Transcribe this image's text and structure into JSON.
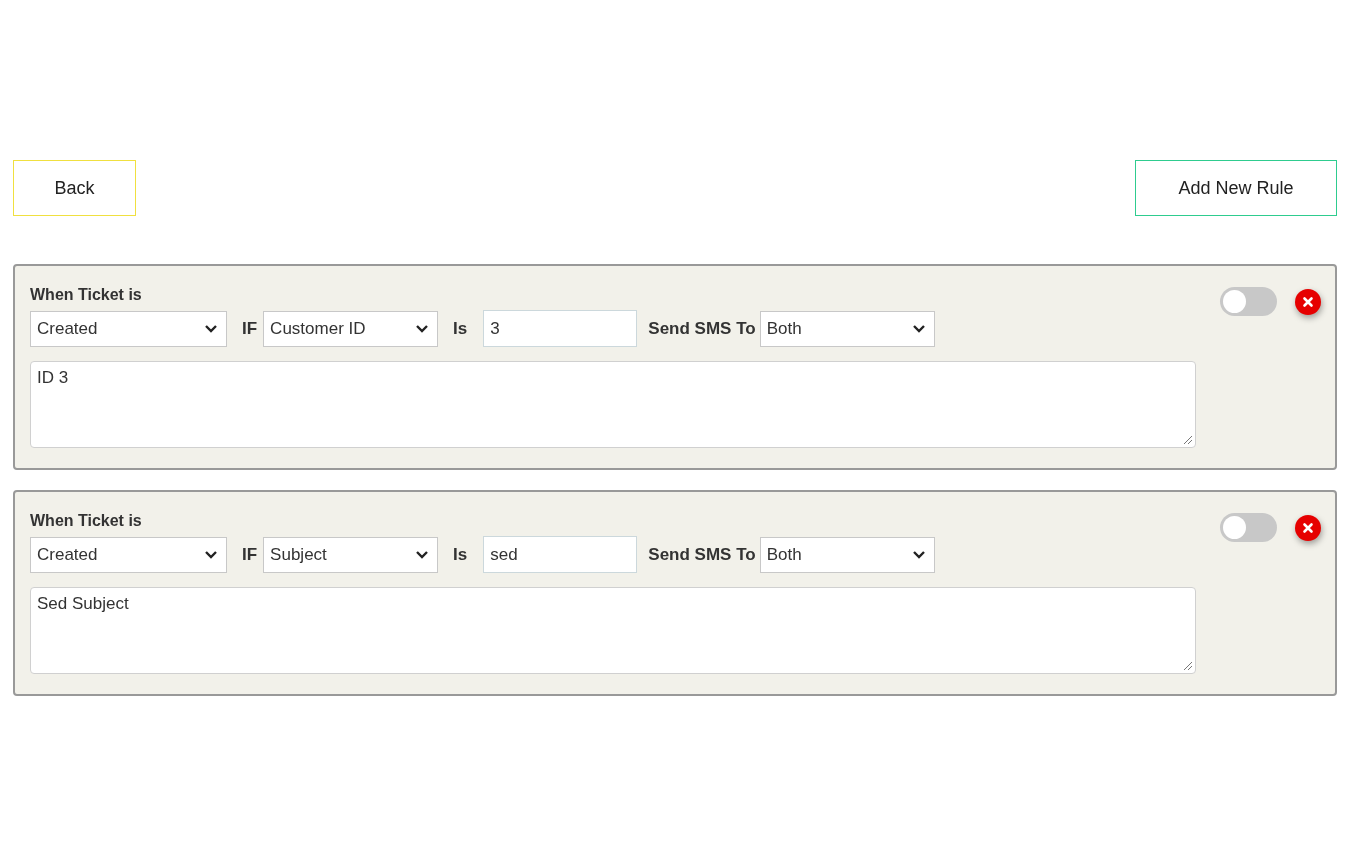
{
  "back_button": "Back",
  "add_button": "Add New Rule",
  "rules": [
    {
      "title": "When Ticket is",
      "event": "Created",
      "if_label": "IF",
      "field": "Customer ID",
      "is_label": "Is",
      "value": "3",
      "send_label": "Send SMS To",
      "recipient": "Both",
      "message": "ID 3",
      "on": false
    },
    {
      "title": "When Ticket is",
      "event": "Created",
      "if_label": "IF",
      "field": "Subject",
      "is_label": "Is",
      "value": "sed",
      "send_label": "Send SMS To",
      "recipient": "Both",
      "message": "Sed Subject",
      "on": false
    }
  ]
}
